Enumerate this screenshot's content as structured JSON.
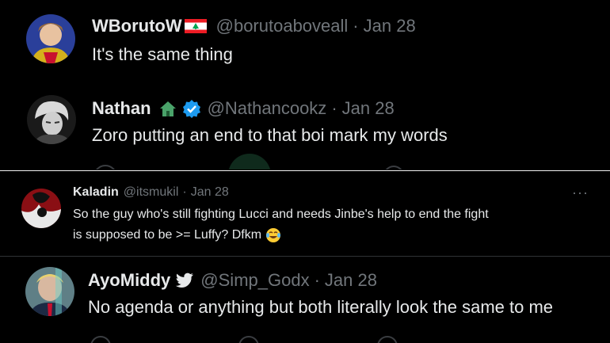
{
  "tweets": [
    {
      "name": "WBorutoW",
      "handle": "@borutoaboveall",
      "sep": "·",
      "date": "Jan 28",
      "text": "It's the same thing",
      "flag": "lebanon-flag-icon"
    },
    {
      "name": "Nathan",
      "handle": "@Nathancookz",
      "sep": "·",
      "date": "Jan 28",
      "text": "Zoro putting an end to that boi mark my words",
      "badges": [
        "house-emoji-icon",
        "verified-badge-icon"
      ]
    },
    {
      "name": "Kaladin",
      "handle": "@itsmukil",
      "sep": "·",
      "date": "Jan 28",
      "more": "···",
      "text_line1": "So the guy who's still fighting Lucci and needs Jinbe's help to end the fight",
      "text_line2": "is supposed to be >= Luffy? Dfkm",
      "emoji": "laughing-crying-emoji-icon"
    },
    {
      "name": "AyoMiddy",
      "handle": "@Simp_Godx",
      "sep": "·",
      "date": "Jan 28",
      "text": "No agenda or anything but both literally look the same to me",
      "badges": [
        "bird-icon"
      ]
    }
  ],
  "colors": {
    "background": "#000000",
    "text": "#e7e9ea",
    "muted": "#71767b",
    "verified": "#1d9bf0",
    "divider": "#2f3336"
  }
}
